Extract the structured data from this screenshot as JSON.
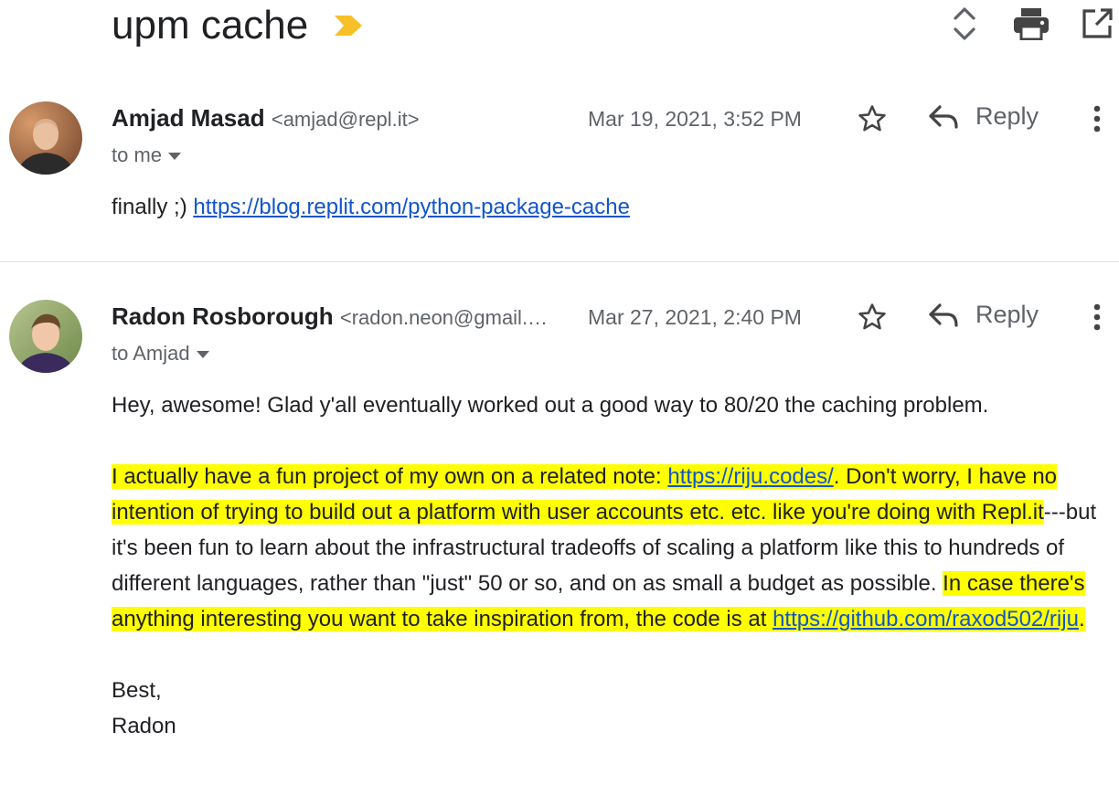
{
  "thread": {
    "subject": "upm cache"
  },
  "messages": [
    {
      "sender_name": "Amjad Masad",
      "sender_email": "<amjad@repl.it>",
      "date": "Mar 19, 2021, 3:52 PM",
      "recipients": "to me",
      "reply_label": "Reply",
      "body_prefix": "finally ;) ",
      "body_link": "https://blog.replit.com/python-package-cache"
    },
    {
      "sender_name": "Radon Rosborough",
      "sender_email": "<radon.neon@gmail.…",
      "date": "Mar 27, 2021, 2:40 PM",
      "recipients": "to Amjad",
      "reply_label": "Reply",
      "p1": "Hey, awesome! Glad y'all eventually worked out a good way to 80/20 the caching problem.",
      "p2_hl_a": "I actually have a fun project of my own on a related note: ",
      "p2_link1": "https://riju.codes/",
      "p2_hl_b": ". Don't worry, I have no intention of trying to build out a platform with user accounts etc. etc. like you're doing with Repl.it",
      "p2_plain": "---but it's been fun to learn about the infrastructural tradeoffs of scaling a platform like this to hundreds of different languages, rather than \"just\" 50 or so, and on as small a budget as possible. ",
      "p2_hl_c": "In case there's anything interesting you want to take inspiration from, the code is at ",
      "p2_link2": "https://github.com/raxod502/riju",
      "p2_hl_d": ".",
      "signoff": "Best,",
      "signature": "Radon"
    }
  ],
  "icons": {
    "label": "label-important-icon",
    "expand": "unfold-icon",
    "print": "print-icon",
    "popout": "open-in-new-icon",
    "star": "star-outline-icon",
    "reply": "reply-icon",
    "more": "more-vert-icon"
  },
  "colors": {
    "label_tag": "#f6c026",
    "highlight": "#ffff00",
    "link": "#1155cc"
  }
}
